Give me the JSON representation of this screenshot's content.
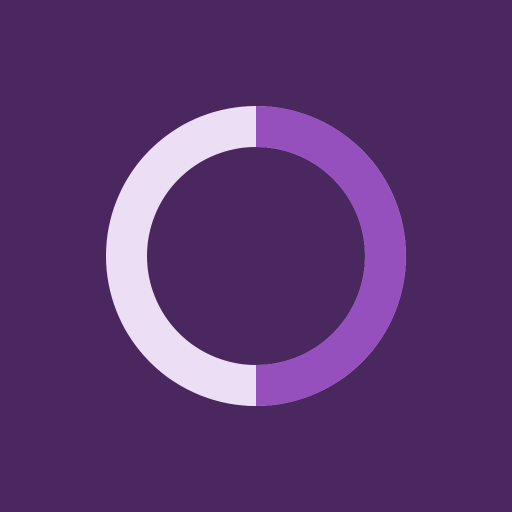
{
  "colors": {
    "background": "#4b2760",
    "track": "#ecdff5",
    "progress": "#9650be"
  },
  "progress": {
    "fraction": 0.5,
    "direction": "clockwise-from-top"
  }
}
